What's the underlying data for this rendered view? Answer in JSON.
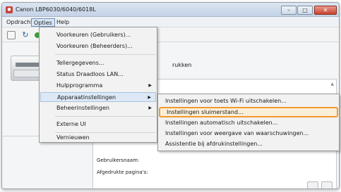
{
  "window": {
    "title": "Canon LBP6030/6040/6018L",
    "controls": {
      "minimize": "–",
      "maximize": "□",
      "close": "✕"
    }
  },
  "menubar": {
    "items": [
      {
        "label": "Opdracht"
      },
      {
        "label": "Opties"
      },
      {
        "label": "Help"
      }
    ]
  },
  "toolbar": {
    "icons": [
      "page-icon",
      "refresh-icon",
      "status-icon"
    ]
  },
  "content": {
    "heading": "rukken",
    "labels": {
      "user": "Gebruikersnaam:",
      "pages": "Afgedrukte pagina's:"
    }
  },
  "options_menu": {
    "items": [
      {
        "label": "Voorkeuren (Gebruikers)..."
      },
      {
        "label": "Voorkeuren (Beheerders)..."
      },
      {
        "label": "Tellergegevens..."
      },
      {
        "label": "Status Draadloos LAN..."
      },
      {
        "label": "Hulpprogramma"
      },
      {
        "label": "Apparaatinstellingen"
      },
      {
        "label": "Beheerinstellingen"
      },
      {
        "label": "Externe UI"
      },
      {
        "label": "Vernieuwen"
      }
    ]
  },
  "submenu": {
    "items": [
      {
        "label": "Instellingen voor toets Wi-Fi uitschakelen..."
      },
      {
        "label": "Instellingen sluimerstand..."
      },
      {
        "label": "Instellingen automatisch uitschakelen..."
      },
      {
        "label": "Instellingen voor weergave van waarschuwingen..."
      },
      {
        "label": "Assistentie bij afdrukinstellingen..."
      }
    ]
  },
  "colors": {
    "highlight_border": "#f09a2e",
    "menu_active": "#dce8f5",
    "close_button": "#c6452f"
  }
}
